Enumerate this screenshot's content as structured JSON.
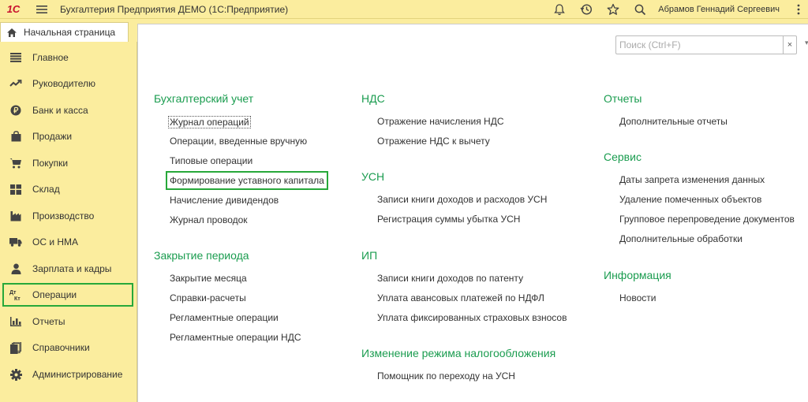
{
  "app": {
    "logo": "1С",
    "title": "Бухгалтерия Предприятия ДЕМО  (1С:Предприятие)",
    "username": "Абрамов Геннадий Сергеевич"
  },
  "tabs": {
    "home_label": "Начальная страница"
  },
  "sidebar": {
    "items": [
      {
        "label": "Главное",
        "icon": "list-icon"
      },
      {
        "label": "Руководителю",
        "icon": "trend-icon"
      },
      {
        "label": "Банк и касса",
        "icon": "ruble-coin-icon"
      },
      {
        "label": "Продажи",
        "icon": "shopping-bag-icon"
      },
      {
        "label": "Покупки",
        "icon": "cart-icon"
      },
      {
        "label": "Склад",
        "icon": "warehouse-grid-icon"
      },
      {
        "label": "Производство",
        "icon": "factory-icon"
      },
      {
        "label": "ОС и НМА",
        "icon": "truck-icon"
      },
      {
        "label": "Зарплата и кадры",
        "icon": "person-icon"
      },
      {
        "label": "Операции",
        "icon": "dt-kt-icon",
        "icon_text_top": "Дт",
        "icon_text_bottom": "Кт",
        "active": true
      },
      {
        "label": "Отчеты",
        "icon": "bar-chart-icon"
      },
      {
        "label": "Справочники",
        "icon": "books-icon"
      },
      {
        "label": "Администрирование",
        "icon": "gear-icon"
      }
    ]
  },
  "search": {
    "placeholder": "Поиск (Ctrl+F)",
    "value": "",
    "clear_label": "×"
  },
  "sections": {
    "buh": {
      "title": "Бухгалтерский учет",
      "links": [
        "Журнал операций",
        "Операции, введенные вручную",
        "Типовые операции",
        "Формирование уставного капитала",
        "Начисление дивидендов",
        "Журнал проводок"
      ]
    },
    "closing": {
      "title": "Закрытие периода",
      "links": [
        "Закрытие месяца",
        "Справки-расчеты",
        "Регламентные операции",
        "Регламентные операции НДС"
      ]
    },
    "nds": {
      "title": "НДС",
      "links": [
        "Отражение начисления НДС",
        "Отражение НДС к вычету"
      ]
    },
    "usn": {
      "title": "УСН",
      "links": [
        "Записи книги доходов и расходов УСН",
        "Регистрация суммы убытка УСН"
      ]
    },
    "ip": {
      "title": "ИП",
      "links": [
        "Записи книги доходов по патенту",
        "Уплата авансовых платежей по НДФЛ",
        "Уплата фиксированных страховых взносов"
      ]
    },
    "regime": {
      "title": "Изменение режима налогообложения",
      "links": [
        "Помощник по переходу на УСН"
      ]
    },
    "reports": {
      "title": "Отчеты",
      "links": [
        "Дополнительные отчеты"
      ]
    },
    "service": {
      "title": "Сервис",
      "links": [
        "Даты запрета изменения данных",
        "Удаление помеченных объектов",
        "Групповое перепроведение документов",
        "Дополнительные обработки"
      ]
    },
    "info": {
      "title": "Информация",
      "links": [
        "Новости"
      ]
    }
  },
  "colors": {
    "panel_bg": "#fbed9e",
    "section_title": "#1a9c4f",
    "highlight_outline": "#27a83a",
    "logo_red": "#c8102e"
  }
}
